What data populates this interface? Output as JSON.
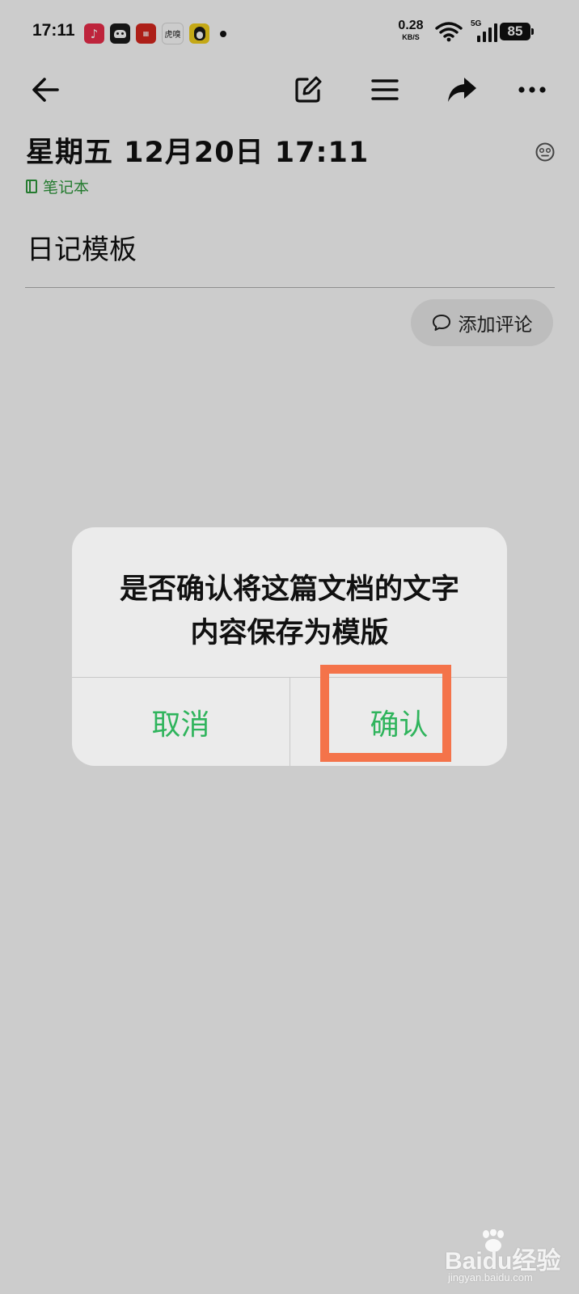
{
  "status_bar": {
    "time": "17:11",
    "net_speed_value": "0.28",
    "net_speed_unit": "KB/S",
    "network_type": "5G",
    "battery_level": "85",
    "notification_apps": [
      "music-app-icon",
      "robot-app-icon",
      "news-app-icon",
      "hupu-app-icon",
      "qq-app-icon"
    ],
    "hupu_label": "虎嗅"
  },
  "toolbar": {
    "icons": [
      "back-arrow-icon",
      "edit-icon",
      "outline-list-icon",
      "share-icon",
      "more-icon"
    ]
  },
  "note": {
    "title": "星期五 12月20日 17:11",
    "notebook": "笔记本",
    "body": "日记模板",
    "comment_button": "添加评论"
  },
  "dialog": {
    "message_line1": "是否确认将这篇文档的文字",
    "message_line2": "内容保存为模版",
    "cancel_label": "取消",
    "confirm_label": "确认"
  },
  "watermark": {
    "brand": "Baidu经验",
    "url": "jingyan.baidu.com"
  },
  "colors": {
    "accent_green": "#2fb45c",
    "notebook_green": "#2f9a3c",
    "highlight": "#f4734a",
    "dialog_bg": "#ebebeb"
  }
}
